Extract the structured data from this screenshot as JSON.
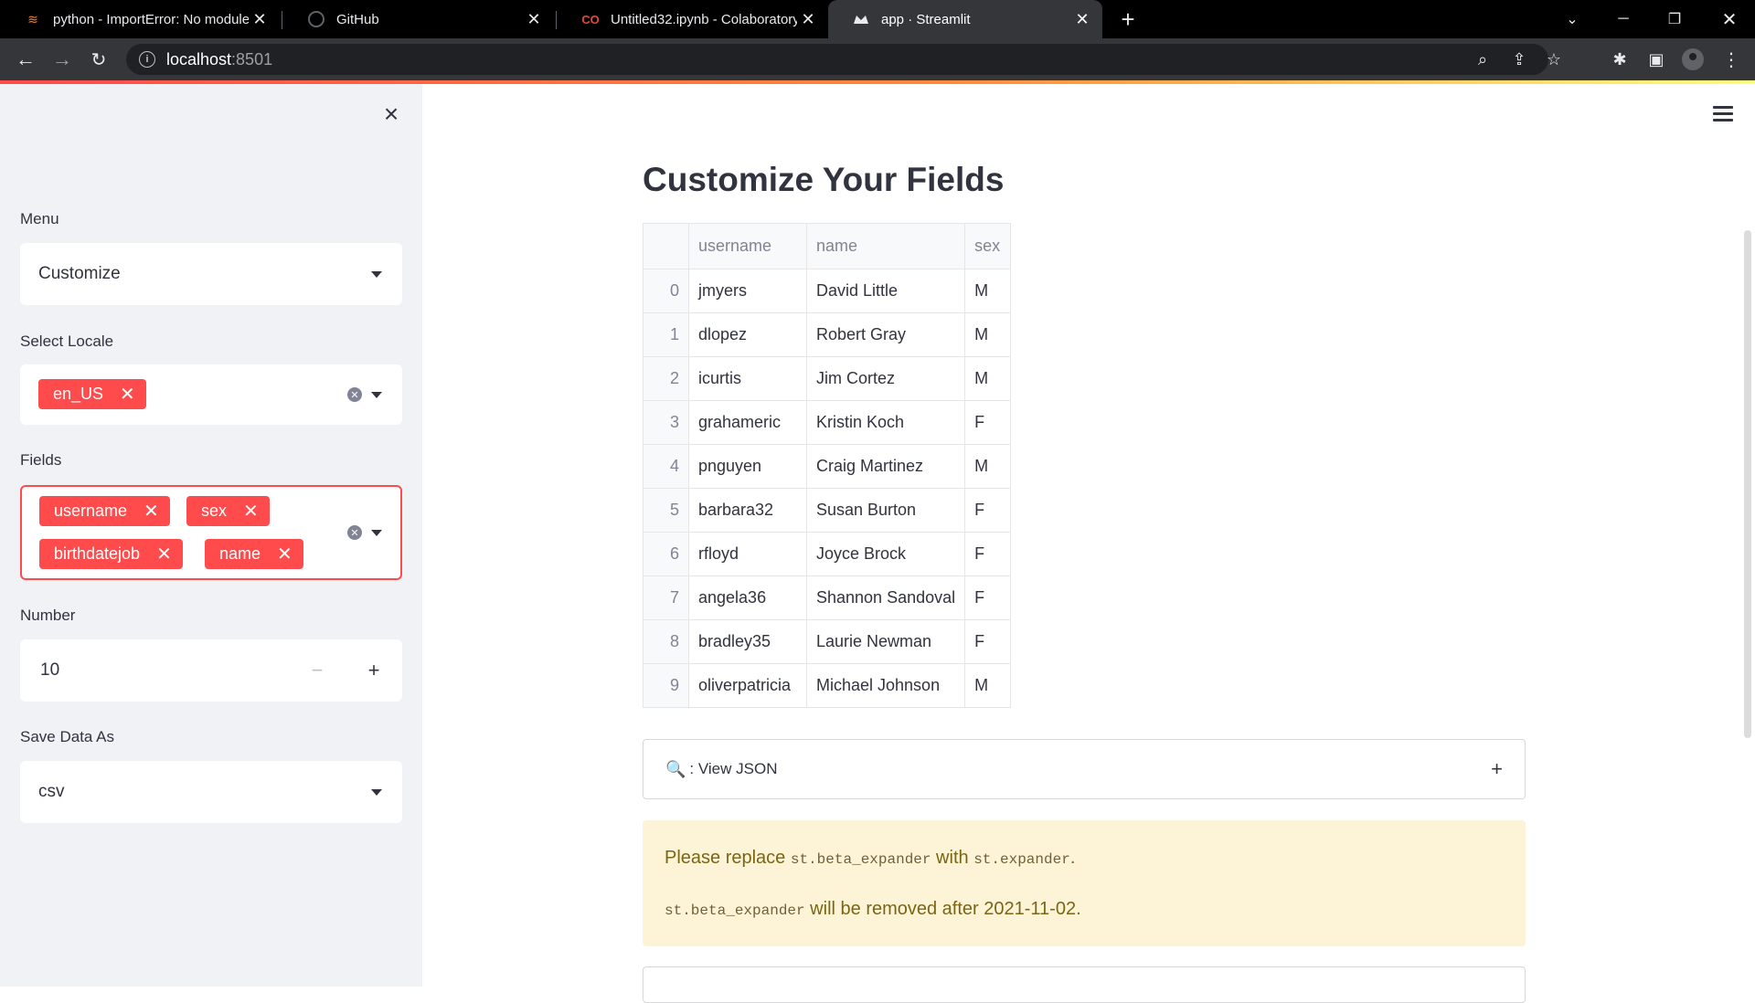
{
  "browser": {
    "tabs": [
      {
        "title": "python - ImportError: No module",
        "icon": "stackoverflow-icon"
      },
      {
        "title": "GitHub",
        "icon": "github-icon"
      },
      {
        "title": "Untitled32.ipynb - Colaboratory",
        "icon": "colab-icon"
      },
      {
        "title": "app · Streamlit",
        "icon": "streamlit-icon",
        "active": true
      }
    ],
    "url_host": "localhost",
    "url_port": ":8501"
  },
  "sidebar": {
    "menu_label": "Menu",
    "menu_value": "Customize",
    "locale_label": "Select Locale",
    "locale_tags": [
      "en_US"
    ],
    "fields_label": "Fields",
    "field_tags": [
      "username",
      "sex",
      "birthdatejob",
      "name"
    ],
    "number_label": "Number",
    "number_value": "10",
    "number_minus": "−",
    "number_plus": "+",
    "save_label": "Save Data As",
    "save_value": "csv"
  },
  "main": {
    "title": "Customize Your Fields",
    "table": {
      "columns": [
        "",
        "username",
        "name",
        "sex"
      ],
      "rows": [
        [
          "0",
          "jmyers",
          "David Little",
          "M"
        ],
        [
          "1",
          "dlopez",
          "Robert Gray",
          "M"
        ],
        [
          "2",
          "icurtis",
          "Jim Cortez",
          "M"
        ],
        [
          "3",
          "grahameric",
          "Kristin Koch",
          "F"
        ],
        [
          "4",
          "pnguyen",
          "Craig Martinez",
          "M"
        ],
        [
          "5",
          "barbara32",
          "Susan Burton",
          "F"
        ],
        [
          "6",
          "rfloyd",
          "Joyce Brock",
          "F"
        ],
        [
          "7",
          "angela36",
          "Shannon Sandoval",
          "F"
        ],
        [
          "8",
          "bradley35",
          "Laurie Newman",
          "F"
        ],
        [
          "9",
          "oliverpatricia",
          "Michael Johnson",
          "M"
        ]
      ]
    },
    "expander_label": ": View JSON",
    "expander_plus": "+",
    "warning": {
      "line1_pre": "Please replace ",
      "line1_code1": "st.beta_expander",
      "line1_mid": " with ",
      "line1_code2": "st.expander",
      "line1_post": ".",
      "line2_code": "st.beta_expander",
      "line2_post": " will be removed after 2021-11-02."
    }
  },
  "colors": {
    "accent": "#ff4b4b",
    "sidebar_bg": "#f0f2f6",
    "warning_bg": "#fdf4d8",
    "text": "#31333f"
  }
}
